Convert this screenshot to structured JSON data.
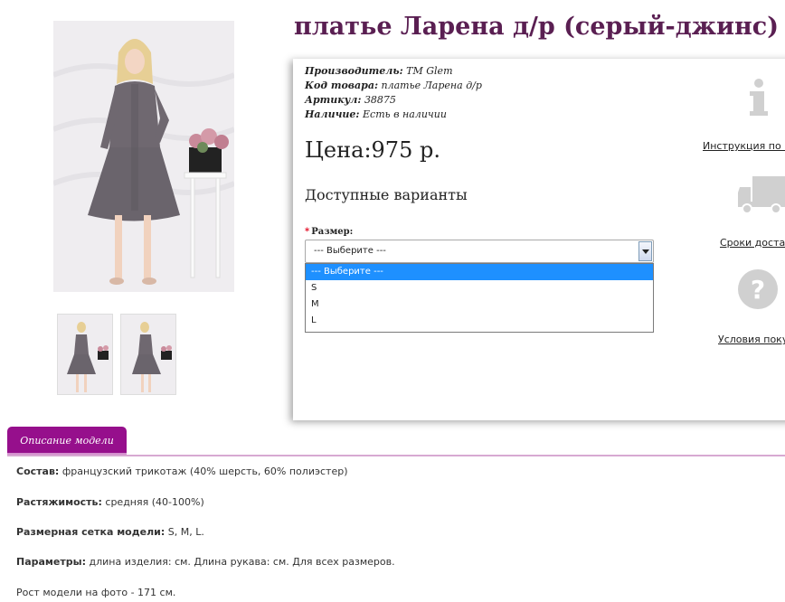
{
  "product": {
    "title": "платье Ларена д/р (серый-джинс)",
    "meta": {
      "manufacturer_label": "Производитель:",
      "manufacturer_value": "TM Glem",
      "code_label": "Код товара:",
      "code_value": "платье Ларена д/р",
      "article_label": "Артикул:",
      "article_value": "38875",
      "availability_label": "Наличие:",
      "availability_value": "Есть в наличии"
    },
    "price": "Цена:975 р.",
    "variants_title": "Доступные варианты",
    "size_label": "Размер:",
    "size_required_mark": "*",
    "select": {
      "selected": "--- Выберите ---",
      "options": [
        "--- Выберите ---",
        "S",
        "M",
        "L"
      ]
    }
  },
  "side_links": {
    "instructions": "Инструкция по по",
    "delivery": "Сроки доставк",
    "purchase": "Условия покуп"
  },
  "colors": {
    "title": "#5a1f52",
    "tab": "#960f8c",
    "selection": "#1e90ff"
  },
  "description": {
    "tab_label": "Описание модели",
    "composition_label": "Состав:",
    "composition_value": "французский трикотаж (40% шерсть, 60% полиэстер)",
    "stretch_label": "Растяжимость:",
    "stretch_value": "средняя (40-100%)",
    "sizes_label": "Размерная сетка модели:",
    "sizes_value": "S, M, L.",
    "params_label": "Параметры:",
    "params_value": "длина изделия: см. Длина рукава: см. Для всех размеров.",
    "model_height": "Рост модели на фото - 171 см."
  }
}
